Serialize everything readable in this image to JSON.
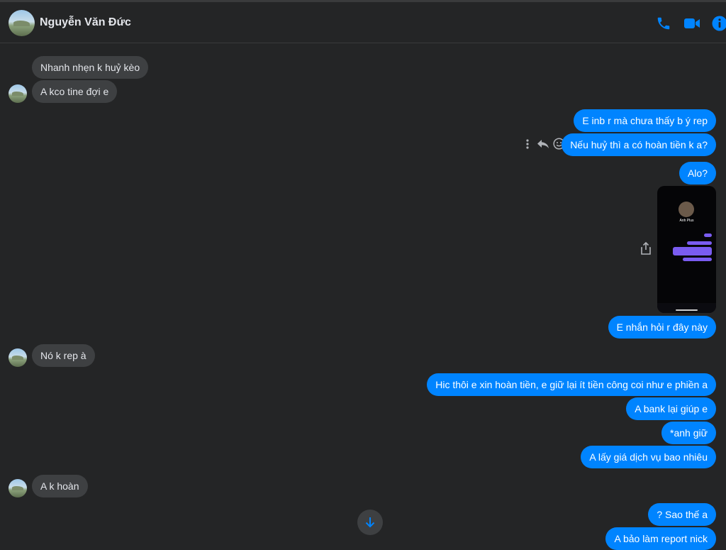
{
  "header": {
    "contact_name": "Nguyễn Văn Đức",
    "icons": [
      "phone-icon",
      "video-camera-icon",
      "info-icon"
    ]
  },
  "colors": {
    "background": "#242526",
    "incoming_bubble": "#3e4042",
    "outgoing_bubble": "#0084ff",
    "accent": "#0084ff"
  },
  "messages": [
    {
      "side": "in",
      "text": "Nhanh nhẹn k huỷ kèo"
    },
    {
      "side": "in",
      "text": "A kco tine đợi e"
    },
    {
      "side": "out",
      "text": "E inb r mà chưa thấy b ý rep"
    },
    {
      "side": "out",
      "text": "Nếu huỷ thì a có hoàn tiền k a?"
    },
    {
      "side": "out",
      "text": "Alo?"
    },
    {
      "side": "out",
      "type": "image",
      "image_text": {
        "name": "Anh Plus"
      }
    },
    {
      "side": "out",
      "text": "E nhắn hỏi r đây này"
    },
    {
      "side": "in",
      "text": "Nó k rep à"
    },
    {
      "side": "out",
      "text": "Hic thôi e xin hoàn tiền, e giữ lại ít tiền công coi như e phiền a"
    },
    {
      "side": "out",
      "text": "A bank lại giúp e"
    },
    {
      "side": "out",
      "text": "*anh giữ"
    },
    {
      "side": "out",
      "text": "A lấy giá dịch vụ bao nhiêu"
    },
    {
      "side": "in",
      "text": "A k hoàn"
    },
    {
      "side": "out",
      "text": "? Sao thế a"
    },
    {
      "side": "out",
      "text": "A bảo làm report nick"
    }
  ]
}
